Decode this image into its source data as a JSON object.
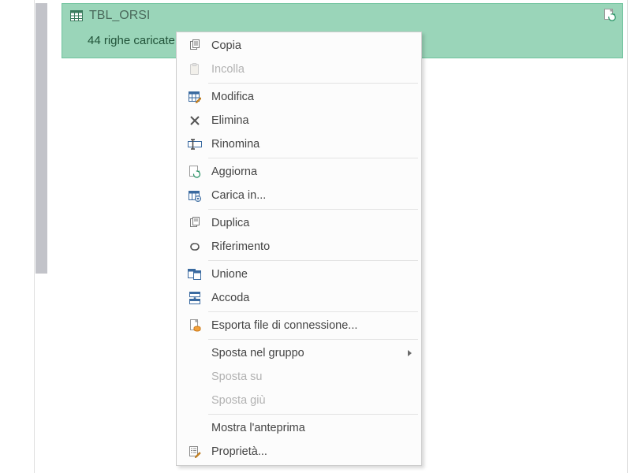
{
  "query": {
    "name": "TBL_ORSI",
    "subtitle": "44 righe caricate."
  },
  "menu": {
    "copia": "Copia",
    "incolla": "Incolla",
    "modifica": "Modifica",
    "elimina": "Elimina",
    "rinomina": "Rinomina",
    "aggiorna": "Aggiorna",
    "carica_in": "Carica in...",
    "duplica": "Duplica",
    "riferimento": "Riferimento",
    "unione": "Unione",
    "accoda": "Accoda",
    "esporta": "Esporta file di connessione...",
    "sposta_gruppo": "Sposta nel gruppo",
    "sposta_su": "Sposta su",
    "sposta_giu": "Sposta giù",
    "anteprima": "Mostra l'anteprima",
    "proprieta": "Proprietà..."
  }
}
